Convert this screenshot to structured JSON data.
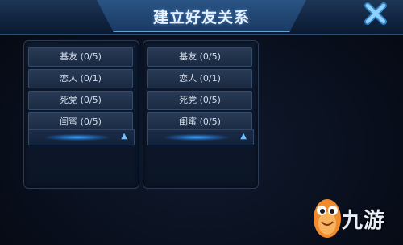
{
  "title": "建立好友关系",
  "panels": [
    {
      "items": [
        {
          "label": "基友 (0/5)"
        },
        {
          "label": "恋人 (0/1)"
        },
        {
          "label": "死党 (0/5)"
        },
        {
          "label": "闺蜜 (0/5)"
        }
      ],
      "expand_icon": "chevron-up-icon"
    },
    {
      "items": [
        {
          "label": "基友 (0/5)"
        },
        {
          "label": "恋人 (0/1)"
        },
        {
          "label": "死党 (0/5)"
        },
        {
          "label": "闺蜜 (0/5)"
        }
      ],
      "expand_icon": "chevron-up-icon"
    }
  ],
  "close_icon": "close-icon",
  "watermark": {
    "text": "九游"
  },
  "colors": {
    "accent": "#3aa4ff",
    "close": "#4fb0f0",
    "text": "#d5deea"
  }
}
